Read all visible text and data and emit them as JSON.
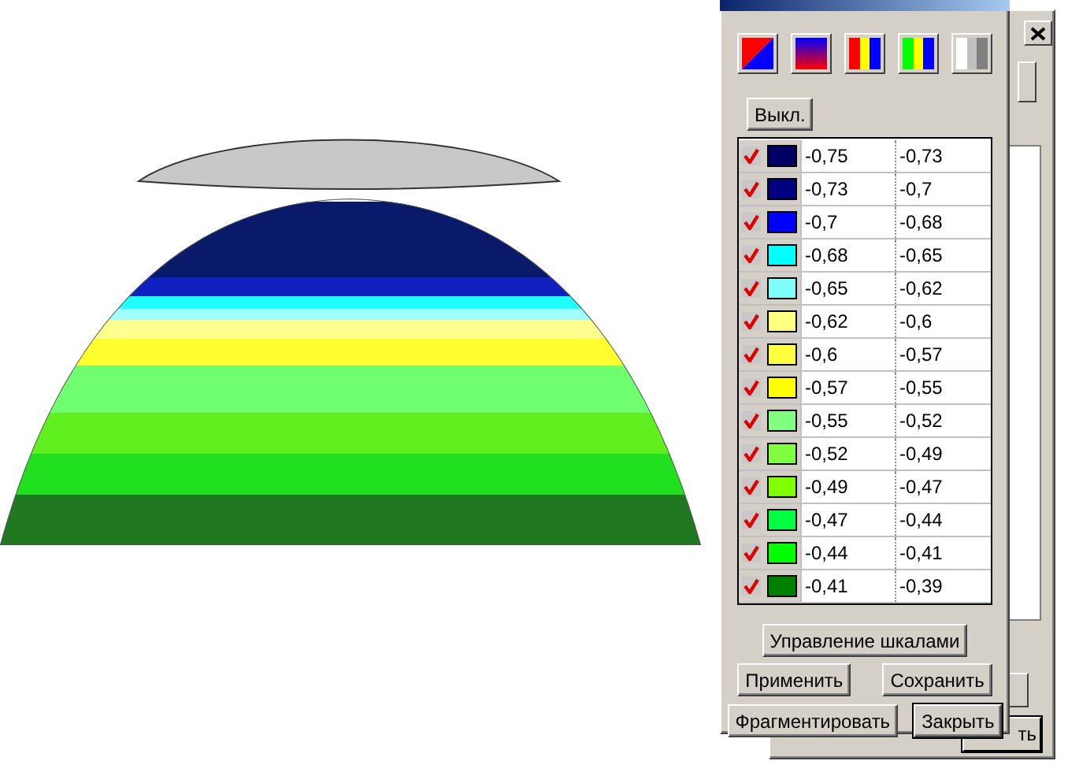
{
  "scale_dialog": {
    "off_button": "Выкл.",
    "rows": [
      {
        "checked": true,
        "color": "#000066",
        "from": "-0,75",
        "to": "-0,73"
      },
      {
        "checked": true,
        "color": "#000080",
        "from": "-0,73",
        "to": "-0,7"
      },
      {
        "checked": true,
        "color": "#0000ff",
        "from": "-0,7",
        "to": "-0,68"
      },
      {
        "checked": true,
        "color": "#00ffff",
        "from": "-0,68",
        "to": "-0,65"
      },
      {
        "checked": true,
        "color": "#80ffff",
        "from": "-0,65",
        "to": "-0,62"
      },
      {
        "checked": true,
        "color": "#ffff80",
        "from": "-0,62",
        "to": "-0,6"
      },
      {
        "checked": true,
        "color": "#ffff40",
        "from": "-0,6",
        "to": "-0,57"
      },
      {
        "checked": true,
        "color": "#ffff00",
        "from": "-0,57",
        "to": "-0,55"
      },
      {
        "checked": true,
        "color": "#80ff80",
        "from": "-0,55",
        "to": "-0,52"
      },
      {
        "checked": true,
        "color": "#80ff40",
        "from": "-0,52",
        "to": "-0,49"
      },
      {
        "checked": true,
        "color": "#80ff00",
        "from": "-0,49",
        "to": "-0,47"
      },
      {
        "checked": true,
        "color": "#00ff40",
        "from": "-0,47",
        "to": "-0,44"
      },
      {
        "checked": true,
        "color": "#00ff00",
        "from": "-0,44",
        "to": "-0,41"
      },
      {
        "checked": true,
        "color": "#008000",
        "from": "-0,41",
        "to": "-0,39"
      }
    ],
    "manage_button": "Управление шкалами",
    "apply_button": "Применить",
    "save_button": "Сохранить",
    "fragment_button": "Фрагментировать",
    "close_button": "Закрыть"
  },
  "back_window": {
    "button_fragment": "ть"
  }
}
